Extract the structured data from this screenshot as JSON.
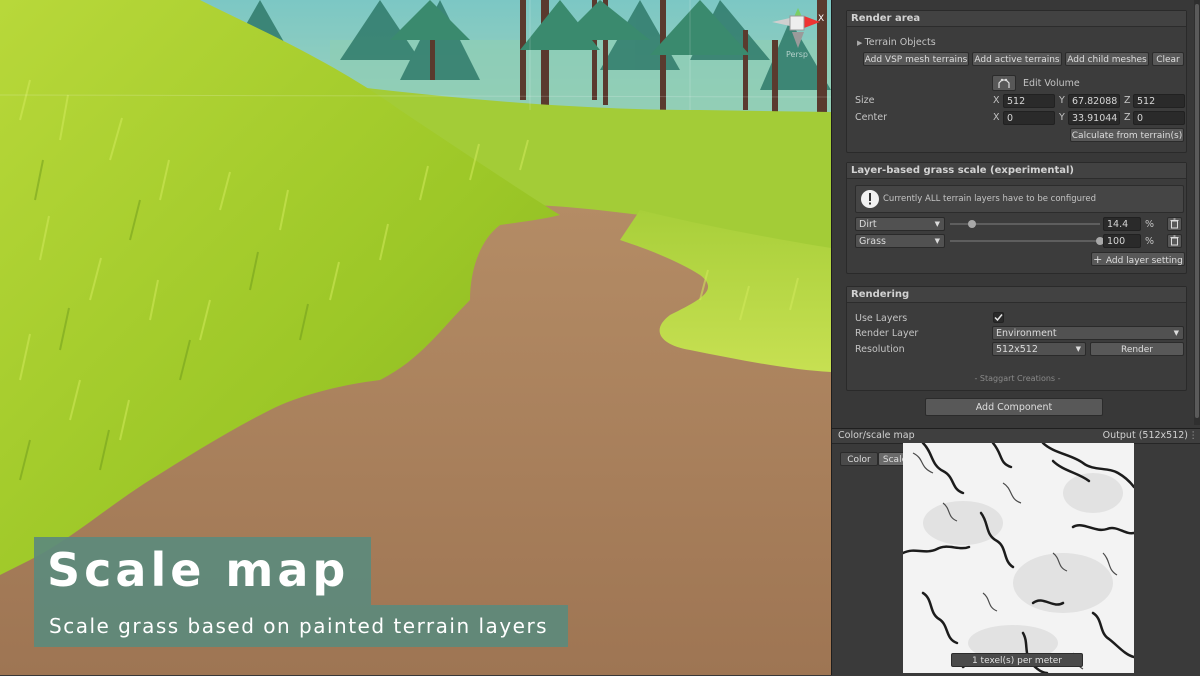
{
  "overlay": {
    "title": "Scale map",
    "subtitle": "Scale grass based on painted terrain layers"
  },
  "gizmo": {
    "axis_label": "X",
    "view_label": "Persp"
  },
  "inspector": {
    "render_area": {
      "header": "Render area",
      "foldout": "Terrain Objects",
      "buttons": {
        "add_vsp": "Add VSP mesh terrains",
        "add_active": "Add active terrains",
        "add_child": "Add child meshes",
        "clear": "Clear"
      },
      "edit_volume": "Edit Volume",
      "size_label": "Size",
      "center_label": "Center",
      "size": {
        "x": "512",
        "y": "67.82088",
        "z": "512"
      },
      "center": {
        "x": "0",
        "y": "33.91044",
        "z": "0"
      },
      "calc_button": "Calculate from terrain(s)"
    },
    "layer_scale": {
      "header": "Layer-based grass scale (experimental)",
      "warning": "Currently ALL terrain layers have to be configured",
      "layers": [
        {
          "name": "Dirt",
          "value": "14.4",
          "unit": "%",
          "fraction": 0.144
        },
        {
          "name": "Grass",
          "value": "100",
          "unit": "%",
          "fraction": 1.0
        }
      ],
      "add_button": "Add layer setting"
    },
    "rendering": {
      "header": "Rendering",
      "use_layers_label": "Use Layers",
      "use_layers_checked": true,
      "render_layer_label": "Render Layer",
      "render_layer_value": "Environment",
      "resolution_label": "Resolution",
      "resolution_value": "512x512",
      "render_button": "Render",
      "credit": "- Staggart Creations -"
    },
    "add_component": "Add Component",
    "color_scale_map": {
      "header": "Color/scale map",
      "output": "Output (512x512)",
      "tabs": [
        "Color",
        "Scale"
      ],
      "active_tab": "Scale",
      "texel_label": "1 texel(s) per meter"
    }
  }
}
